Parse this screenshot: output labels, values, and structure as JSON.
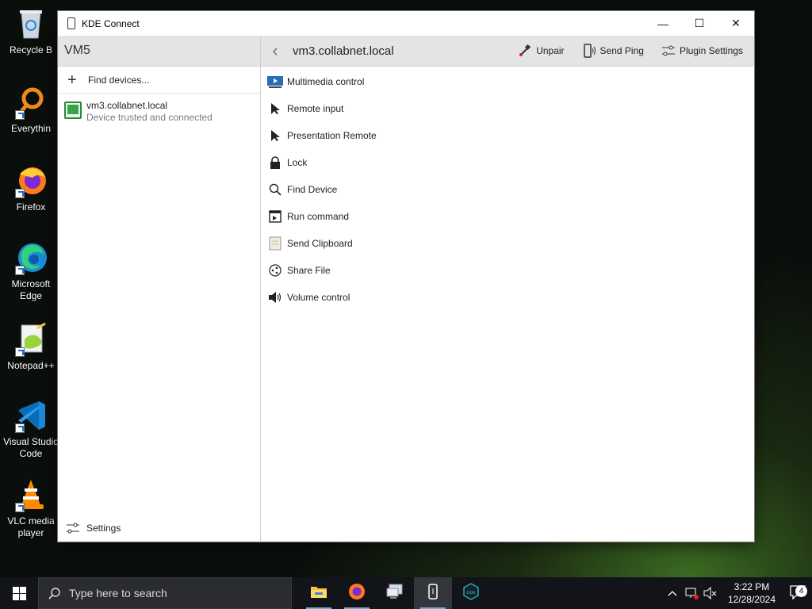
{
  "desktop": {
    "icons": [
      {
        "label": "Recycle B",
        "icon": "recycle-bin-icon"
      },
      {
        "label": "Everythin",
        "icon": "everything-search-icon"
      },
      {
        "label": "Firefox",
        "icon": "firefox-icon"
      },
      {
        "label": "Microsoft Edge",
        "icon": "edge-icon"
      },
      {
        "label": "Notepad++",
        "icon": "notepadpp-icon"
      },
      {
        "label": "Visual Studio Code",
        "icon": "vscode-icon"
      },
      {
        "label": "VLC media player",
        "icon": "vlc-icon"
      }
    ]
  },
  "window": {
    "title": "KDE Connect",
    "controls": {
      "minimize": "—",
      "maximize": "☐",
      "close": "✕"
    }
  },
  "sidebar": {
    "header": "VM5",
    "find_devices": "Find devices...",
    "device": {
      "name": "vm3.collabnet.local",
      "status": "Device trusted and connected"
    },
    "settings": "Settings"
  },
  "main": {
    "device_title": "vm3.collabnet.local",
    "actions": {
      "unpair": "Unpair",
      "send_ping": "Send Ping",
      "plugin_settings": "Plugin Settings"
    },
    "plugins": [
      {
        "label": "Multimedia control",
        "icon": "multimedia-icon"
      },
      {
        "label": "Remote input",
        "icon": "pointer-icon"
      },
      {
        "label": "Presentation Remote",
        "icon": "pointer-icon"
      },
      {
        "label": "Lock",
        "icon": "lock-icon"
      },
      {
        "label": "Find Device",
        "icon": "search-icon"
      },
      {
        "label": "Run command",
        "icon": "terminal-icon"
      },
      {
        "label": "Send Clipboard",
        "icon": "clipboard-icon"
      },
      {
        "label": "Share File",
        "icon": "share-icon"
      },
      {
        "label": "Volume control",
        "icon": "speaker-icon"
      }
    ]
  },
  "taskbar": {
    "search_placeholder": "Type here to search",
    "time": "3:22 PM",
    "date": "12/28/2024",
    "notification_count": "4"
  }
}
